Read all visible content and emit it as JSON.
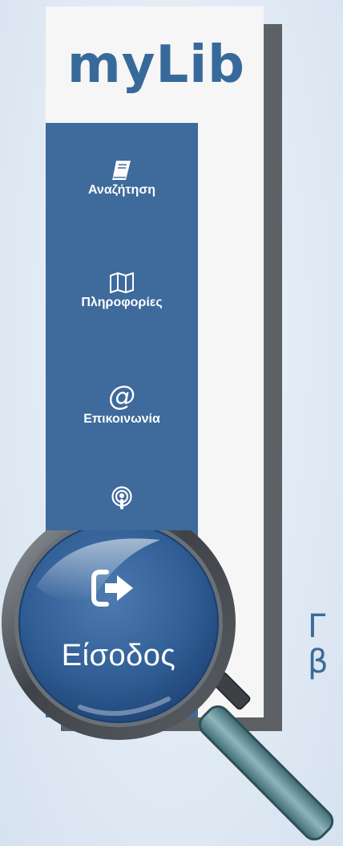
{
  "app": {
    "logo_text": "myLib"
  },
  "sidebar": {
    "items": [
      {
        "label": "Αναζήτηση",
        "icon": "book-icon"
      },
      {
        "label": "Πληροφορίες",
        "icon": "map-icon"
      },
      {
        "label": "Επικοινωνία",
        "icon": "at-icon"
      },
      {
        "label": "",
        "icon": "podcast-icon"
      }
    ]
  },
  "magnifier": {
    "label": "Είσοδος",
    "icon": "sign-in-icon"
  },
  "background_text": {
    "line1": "Γ",
    "line2": "β"
  },
  "colors": {
    "accent": "#3e6a9c",
    "logo": "#376a9b",
    "panel": "#f6f6f6",
    "shadow": "#5d6166",
    "lens_handle": "#5e8c93"
  }
}
